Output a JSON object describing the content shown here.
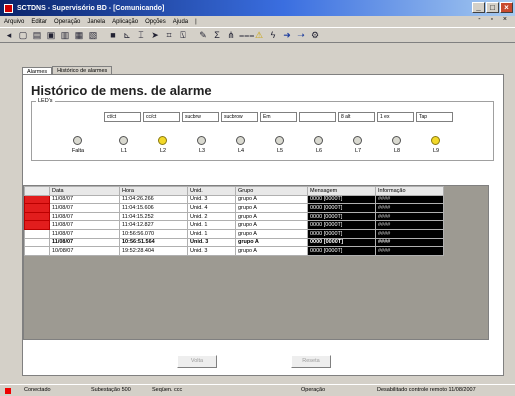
{
  "window": {
    "title": "SCTDNS - Supervisório BD - [Comunicando]"
  },
  "menu": [
    "Arquivo",
    "Editar",
    "Operação",
    "Janela",
    "Aplicação",
    "Opções",
    "Ajuda",
    "|"
  ],
  "tabs": [
    "Alarmes",
    "Histórico de alarmes"
  ],
  "page": {
    "title": "Histórico de mens. de alarme",
    "leds_legend": "LED's",
    "header_boxes": [
      "ct/ct",
      "cc/ct",
      "sucbrw",
      "sucbrow",
      "Em",
      "",
      "8 alt",
      "1 ex",
      "Tap"
    ],
    "leds": [
      {
        "label": "Falta",
        "on": false
      },
      {
        "label": "L1",
        "on": false
      },
      {
        "label": "L2",
        "on": true
      },
      {
        "label": "L3",
        "on": false
      },
      {
        "label": "L4",
        "on": false
      },
      {
        "label": "L5",
        "on": false
      },
      {
        "label": "L6",
        "on": false
      },
      {
        "label": "L7",
        "on": false
      },
      {
        "label": "L8",
        "on": false
      },
      {
        "label": "L9",
        "on": true
      }
    ]
  },
  "table": {
    "headers": [
      "",
      "Data",
      "Hora",
      "Unid.",
      "Grupo",
      "Mensagem",
      "Informação"
    ],
    "rows": [
      {
        "indicator": "red",
        "date": "11/08/07",
        "time": "11:04:26.266",
        "unit": "Unid. 3",
        "group": "grupo A",
        "message": "0000 [0000T]",
        "info": "####",
        "bold": false
      },
      {
        "indicator": "red",
        "date": "11/08/07",
        "time": "11:04:15.606",
        "unit": "Unid. 4",
        "group": "grupo A",
        "message": "0000 [0000T]",
        "info": "####",
        "bold": false
      },
      {
        "indicator": "red",
        "date": "11/08/07",
        "time": "11:04:15.252",
        "unit": "Unid. 2",
        "group": "grupo A",
        "message": "0000 [0000T]",
        "info": "####",
        "bold": false
      },
      {
        "indicator": "red",
        "date": "11/08/07",
        "time": "11:04:12.827",
        "unit": "Unid. 1",
        "group": "grupo A",
        "message": "0000 [0000T]",
        "info": "####",
        "bold": false
      },
      {
        "indicator": "empty",
        "date": "11/08/07",
        "time": "10:56:56.070",
        "unit": "Unid. 1",
        "group": "grupo A",
        "message": "0000 [0000T]",
        "info": "####",
        "bold": false
      },
      {
        "indicator": "empty",
        "date": "11/08/07",
        "time": "10:56:51.564",
        "unit": "Unid. 3",
        "group": "grupo A",
        "message": "0000 [0000T]",
        "info": "####",
        "bold": true
      },
      {
        "indicator": "empty",
        "date": "10/08/07",
        "time": "19:52:28.404",
        "unit": "Unid. 3",
        "group": "grupo A",
        "message": "0000 [0000T]",
        "info": "####",
        "bold": false
      }
    ]
  },
  "buttons": {
    "left": "Volta",
    "right": "Reseta"
  },
  "status": {
    "connection": "Conectado",
    "substation": "Subestação 500",
    "server": "Seqüen. ccc",
    "operation": "Operação",
    "license": "Desabilitado controle remoto 11/08/2007"
  },
  "colors": {
    "alarm_red": "#e21d1d",
    "led_on": "#f2d829",
    "title_blue": "#0a246a"
  }
}
